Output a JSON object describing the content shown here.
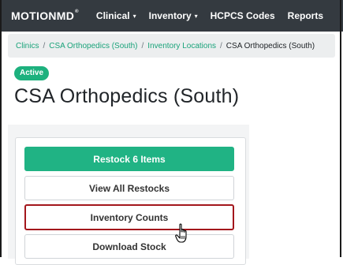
{
  "navbar": {
    "brand": "MOTIONMD",
    "brand_mark": "®",
    "items": [
      {
        "label": "Clinical",
        "has_dropdown": true
      },
      {
        "label": "Inventory",
        "has_dropdown": true
      },
      {
        "label": "HCPCS Codes",
        "has_dropdown": false
      },
      {
        "label": "Reports",
        "has_dropdown": false
      }
    ]
  },
  "breadcrumb": {
    "items": [
      "Clinics",
      "CSA Orthopedics (South)",
      "Inventory Locations"
    ],
    "current": "CSA Orthopedics (South)",
    "separator": "/"
  },
  "status_badge": "Active",
  "page_title": "CSA Orthopedics (South)",
  "actions": {
    "restock": "Restock 6 Items",
    "view_restocks": "View All Restocks",
    "inventory_counts": "Inventory Counts",
    "download_stock": "Download Stock"
  },
  "colors": {
    "navbar_bg": "#343a40",
    "accent": "#20b384",
    "link": "#1aa37a",
    "highlight_border": "#a3161c"
  },
  "icons": {
    "cursor": "hand-pointer-icon",
    "caret": "caret-down-icon"
  }
}
